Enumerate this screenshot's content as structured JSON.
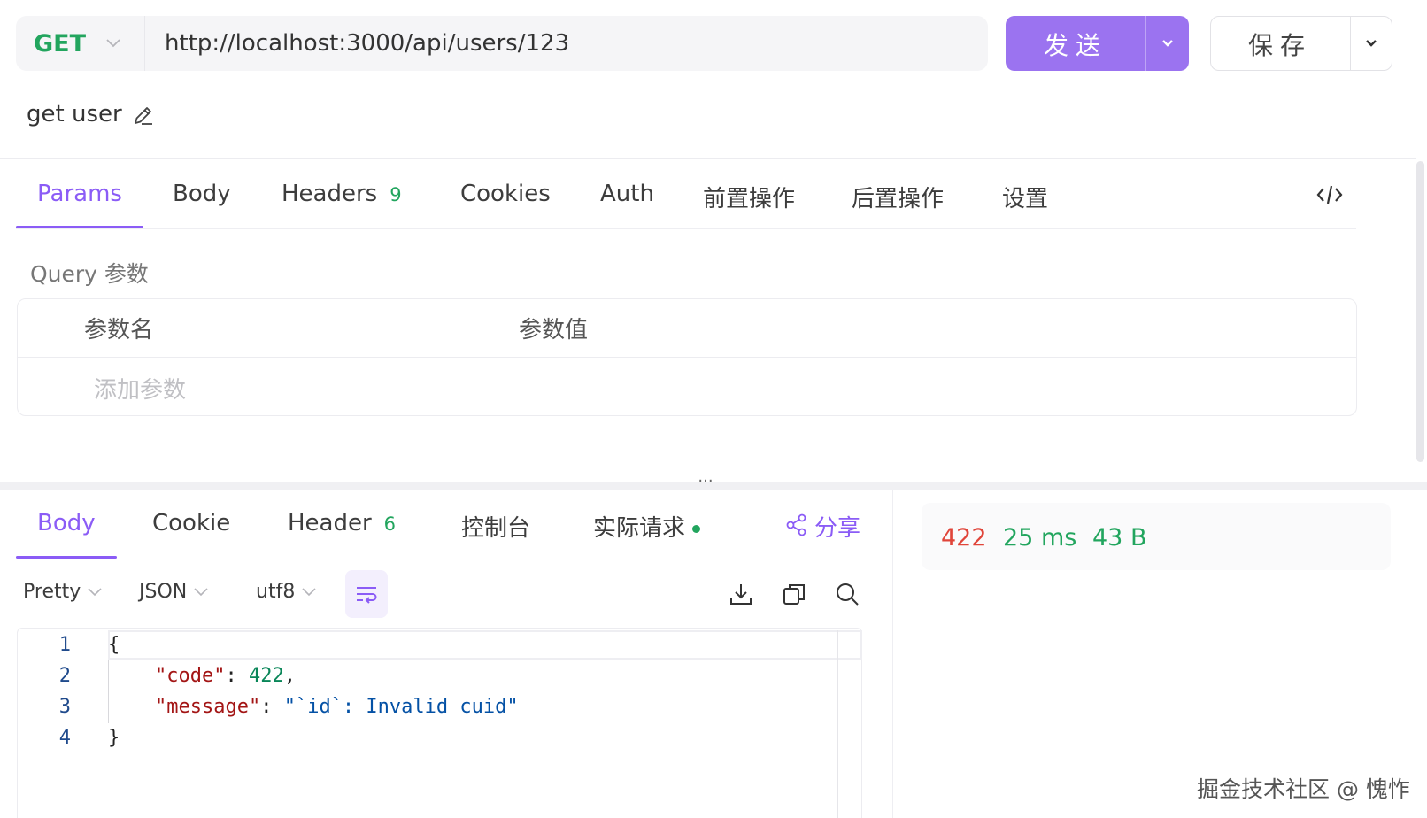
{
  "request": {
    "method": "GET",
    "url": "http://localhost:3000/api/users/123",
    "send_label": "发送",
    "save_label": "保存",
    "name": "get user"
  },
  "request_tabs": [
    {
      "label": "Params",
      "active": true
    },
    {
      "label": "Body"
    },
    {
      "label": "Headers",
      "badge": "9"
    },
    {
      "label": "Cookies"
    },
    {
      "label": "Auth"
    },
    {
      "label": "前置操作"
    },
    {
      "label": "后置操作"
    },
    {
      "label": "设置"
    }
  ],
  "params": {
    "section_title": "Query 参数",
    "col_name": "参数名",
    "col_value": "参数值",
    "add_placeholder": "添加参数"
  },
  "response_tabs": [
    {
      "label": "Body",
      "active": true
    },
    {
      "label": "Cookie"
    },
    {
      "label": "Header",
      "badge": "6"
    },
    {
      "label": "控制台"
    },
    {
      "label": "实际请求"
    }
  ],
  "share_label": "分享",
  "toolbar": {
    "format": "Pretty",
    "type": "JSON",
    "encoding": "utf8"
  },
  "editor": {
    "line_numbers": [
      "1",
      "2",
      "3",
      "4"
    ],
    "lines": {
      "l1": "{",
      "code_key": "\"code\"",
      "code_value": "422",
      "message_key": "\"message\"",
      "message_value": "\"`id`: Invalid cuid\"",
      "l4": "}"
    }
  },
  "response_meta": {
    "status": "422",
    "time": "25 ms",
    "size": "43 B"
  },
  "watermark": "掘金技术社区 @ 愧怍",
  "colors": {
    "accent": "#8b5cf6",
    "send_button": "#9b73f0",
    "method_get": "#22a55e",
    "status_error": "#e0453a",
    "status_ok": "#22a55e"
  }
}
